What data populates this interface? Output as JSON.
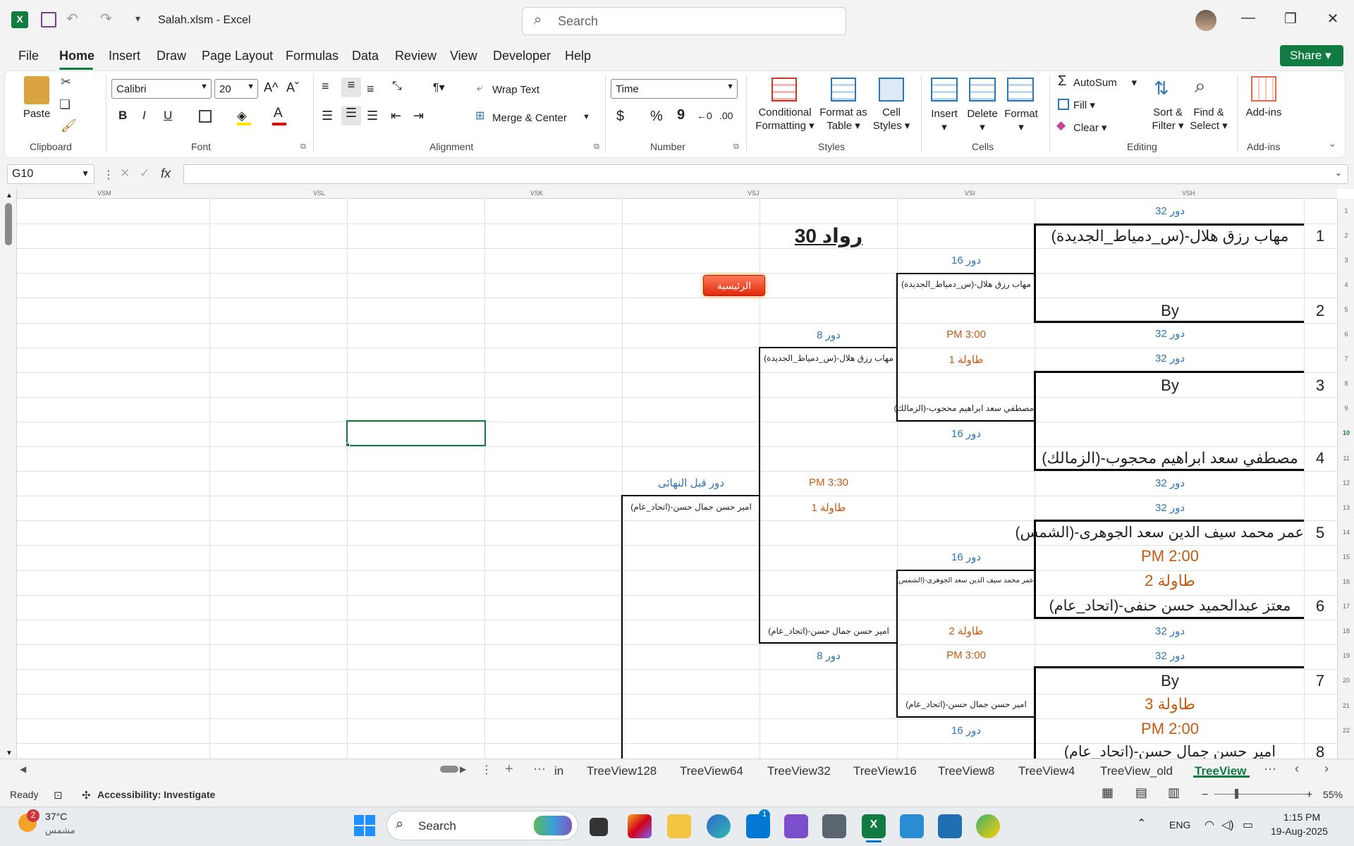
{
  "titlebar": {
    "filename": "Salah.xlsm",
    "separator": " - ",
    "app": "Excel",
    "search_placeholder": "Search"
  },
  "menu": [
    "File",
    "Home",
    "Insert",
    "Draw",
    "Page Layout",
    "Formulas",
    "Data",
    "Review",
    "View",
    "Developer",
    "Help"
  ],
  "share_label": "Share",
  "ribbon": {
    "clipboard": {
      "paste": "Paste",
      "group": "Clipboard"
    },
    "font": {
      "name": "Calibri",
      "size": "20",
      "bold": "B",
      "italic": "I",
      "underline": "U",
      "group": "Font"
    },
    "alignment": {
      "wrap": "Wrap Text",
      "merge": "Merge & Center",
      "group": "Alignment"
    },
    "number": {
      "format": "Time",
      "currency": "$",
      "percent": "%",
      "comma": "9",
      "group": "Number"
    },
    "styles": {
      "conditional": [
        "Conditional",
        "Formatting"
      ],
      "format_table": [
        "Format as",
        "Table"
      ],
      "cell_styles": [
        "Cell",
        "Styles"
      ],
      "group": "Styles"
    },
    "cells": {
      "insert": "Insert",
      "delete": "Delete",
      "format": "Format",
      "group": "Cells"
    },
    "editing": {
      "autosum": "AutoSum",
      "fill": "Fill",
      "clear": "Clear",
      "sort": [
        "Sort &",
        "Filter"
      ],
      "find": [
        "Find &",
        "Select"
      ],
      "group": "Editing"
    },
    "addins": {
      "label": "Add-ins",
      "group": "Add-ins"
    }
  },
  "formula_bar": {
    "name_box": "G10",
    "fx": "fx",
    "value": ""
  },
  "columns": [
    "VSM",
    "VSL",
    "VSK",
    "VSJ",
    "VSI",
    "VSH"
  ],
  "rows": [
    "1",
    "2",
    "3",
    "4",
    "5",
    "6",
    "7",
    "8",
    "9",
    "10",
    "11",
    "12",
    "13",
    "14",
    "15",
    "16",
    "17",
    "18",
    "19",
    "20",
    "21",
    "22"
  ],
  "bracket": {
    "title": "رواد 30",
    "main_button": "الرئيسية",
    "r32": "دور 32",
    "r16": "دور 16",
    "r8": "دور 8",
    "semi": "دور قبل النهائى",
    "by": "By",
    "players": {
      "p1": "مهاب رزق هلال-(س_دمياط_الجديدة)",
      "p4": "مصطفي سعد ابراهيم محجوب-(الزمالك)",
      "p5": "عمر محمد سيف الدين سعد الجوهرى-(الشمس)",
      "p6": "معتز عبدالحميد حسن حنفى-(اتحاد_عام)",
      "p8": "امير حسن جمال حسن-(اتحاد_عام)"
    },
    "seeds": [
      "1",
      "2",
      "3",
      "4",
      "5",
      "6",
      "7",
      "8"
    ],
    "times": {
      "t300": "3:00 PM",
      "t330": "3:30 PM",
      "t200": "2:00 PM"
    },
    "tables": {
      "t1": "طاولة 1",
      "t2": "طاولة 2",
      "t3": "طاولة 3"
    }
  },
  "sheet_tabs": [
    "in",
    "TreeView128",
    "TreeView64",
    "TreeView32",
    "TreeView16",
    "TreeView8",
    "TreeView4",
    "TreeView_old",
    "TreeView"
  ],
  "status": {
    "ready": "Ready",
    "accessibility": "Accessibility: Investigate",
    "zoom": "55%"
  },
  "taskbar": {
    "weather_temp": "37°C",
    "weather_desc": "مشمس",
    "weather_badge": "2",
    "search": "Search",
    "store_badge": "1",
    "lang": "ENG",
    "time": "1:15 PM",
    "date": "19-Aug-2025"
  },
  "colors": {
    "excel_green": "#107c41",
    "round_blue": "#2e75b6",
    "time_orange": "#c55a11"
  }
}
